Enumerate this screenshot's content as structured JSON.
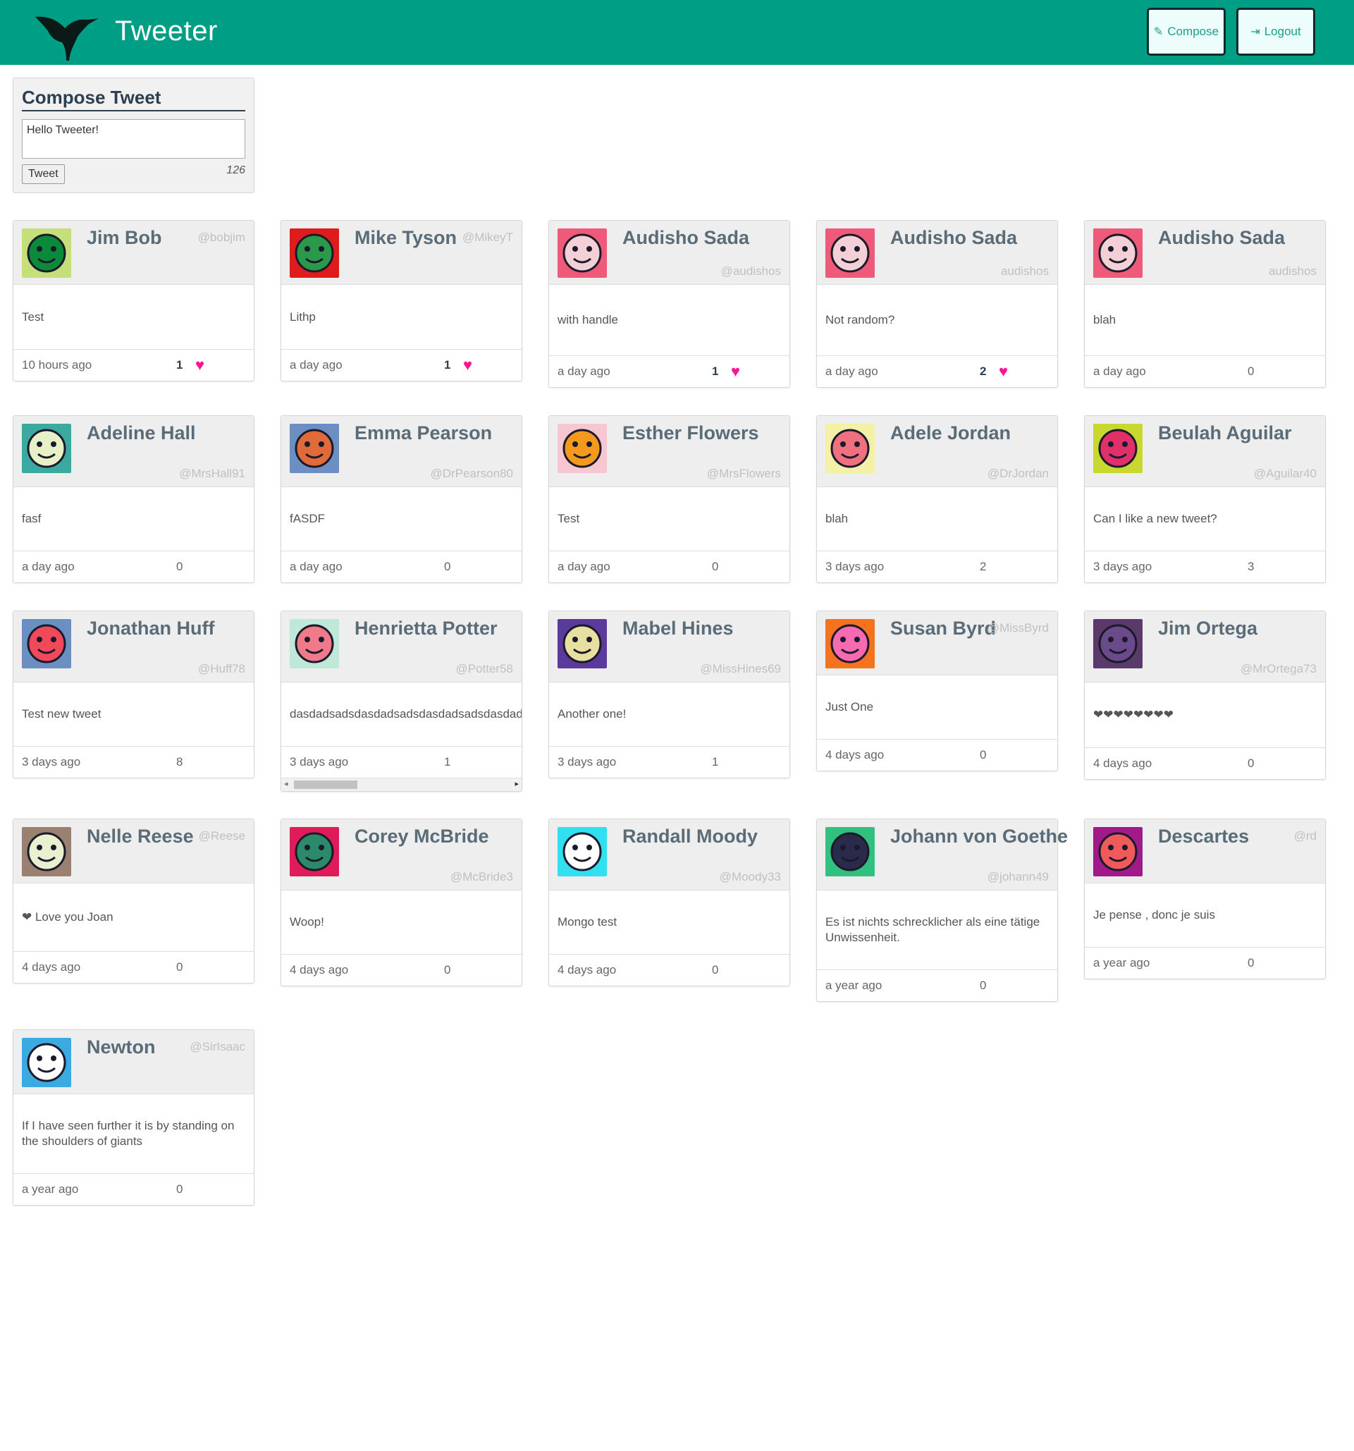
{
  "app": {
    "title": "Tweeter"
  },
  "nav": {
    "compose_label": "Compose",
    "logout_label": "Logout"
  },
  "compose": {
    "title": "Compose Tweet",
    "text": "Hello Tweeter!",
    "button": "Tweet",
    "count": "126"
  },
  "colors": {
    "header": "#009e85",
    "like": "#ff1493"
  },
  "tweets": [
    {
      "name": "Jim Bob",
      "handle": "@bobjim",
      "text": "Test",
      "time": "10 hours ago",
      "likes": "1",
      "liked": true,
      "avatar_bg": "#c5e07a",
      "avatar_fg": "#0a8a3a",
      "avatar_icon": "face-icon"
    },
    {
      "name": "Mike Tyson",
      "handle": "@MikeyT",
      "text": "Lithp",
      "time": "a day ago",
      "likes": "1",
      "liked": true,
      "avatar_bg": "#e01b1b",
      "avatar_fg": "#2a9a4a",
      "avatar_icon": "face-icon"
    },
    {
      "name": "Audisho Sada",
      "handle": "@audishos",
      "text": "with handle",
      "time": "a day ago",
      "likes": "1",
      "liked": true,
      "avatar_bg": "#f05a7a",
      "avatar_fg": "#f3d0d5",
      "avatar_icon": "face-icon"
    },
    {
      "name": "Audisho Sada",
      "handle": "audishos",
      "text": "Not random?",
      "time": "a day ago",
      "likes": "2",
      "liked": true,
      "avatar_bg": "#f05a7a",
      "avatar_fg": "#f3d0d5",
      "avatar_icon": "face-icon"
    },
    {
      "name": "Audisho Sada",
      "handle": "audishos",
      "text": "blah",
      "time": "a day ago",
      "likes": "0",
      "liked": false,
      "avatar_bg": "#f05a7a",
      "avatar_fg": "#f3d0d5",
      "avatar_icon": "face-icon"
    },
    {
      "name": "Adeline Hall",
      "handle": "@MrsHall91",
      "text": "fasf",
      "time": "a day ago",
      "likes": "0",
      "liked": false,
      "avatar_bg": "#3aa9a0",
      "avatar_fg": "#e8f0c8",
      "avatar_icon": "face-icon"
    },
    {
      "name": "Emma Pearson",
      "handle": "@DrPearson80",
      "text": "fASDF",
      "time": "a day ago",
      "likes": "0",
      "liked": false,
      "avatar_bg": "#6a8fc0",
      "avatar_fg": "#e06a3a",
      "avatar_icon": "face-icon"
    },
    {
      "name": "Esther Flowers",
      "handle": "@MrsFlowers",
      "text": "Test",
      "time": "a day ago",
      "likes": "0",
      "liked": false,
      "avatar_bg": "#f7c6d0",
      "avatar_fg": "#f39a1e",
      "avatar_icon": "face-icon"
    },
    {
      "name": "Adele Jordan",
      "handle": "@DrJordan",
      "text": "blah",
      "time": "3 days ago",
      "likes": "2",
      "liked": false,
      "avatar_bg": "#f5f0a8",
      "avatar_fg": "#f07080",
      "avatar_icon": "face-icon"
    },
    {
      "name": "Beulah Aguilar",
      "handle": "@Aguilar40",
      "text": "Can I like a new tweet?",
      "time": "3 days ago",
      "likes": "3",
      "liked": false,
      "avatar_bg": "#c8d830",
      "avatar_fg": "#e0306a",
      "avatar_icon": "face-icon"
    },
    {
      "name": "Jonathan Huff",
      "handle": "@Huff78",
      "text": "Test new tweet",
      "time": "3 days ago",
      "likes": "8",
      "liked": false,
      "avatar_bg": "#6a8fc0",
      "avatar_fg": "#f04a5a",
      "avatar_icon": "face-icon"
    },
    {
      "name": "Henrietta Potter",
      "handle": "@Potter58",
      "text": "dasdadsadsdasdadsadsdasdadsadsdasdadsadsdasdadsadsdas",
      "time": "3 days ago",
      "likes": "1",
      "liked": false,
      "avatar_bg": "#bfe8d8",
      "avatar_fg": "#f07a8a",
      "avatar_icon": "face-icon"
    },
    {
      "name": "Mabel Hines",
      "handle": "@MissHines69",
      "text": "Another one!",
      "time": "3 days ago",
      "likes": "1",
      "liked": false,
      "avatar_bg": "#5a3a9a",
      "avatar_fg": "#e8e0a0",
      "avatar_icon": "face-icon"
    },
    {
      "name": "Susan Byrd",
      "handle": "@MissByrd",
      "text": "Just One",
      "time": "4 days ago",
      "likes": "0",
      "liked": false,
      "avatar_bg": "#f5721e",
      "avatar_fg": "#f56ab0",
      "avatar_icon": "face-icon"
    },
    {
      "name": "Jim Ortega",
      "handle": "@MrOrtega73",
      "text": "❤❤❤❤❤❤❤❤",
      "time": "4 days ago",
      "likes": "0",
      "liked": false,
      "avatar_bg": "#5a3a6a",
      "avatar_fg": "#6a4a8a",
      "avatar_icon": "face-icon"
    },
    {
      "name": "Nelle Reese",
      "handle": "@Reese",
      "text": "❤ Love you Joan",
      "time": "4 days ago",
      "likes": "0",
      "liked": false,
      "avatar_bg": "#9a8070",
      "avatar_fg": "#e8f0d0",
      "avatar_icon": "face-icon"
    },
    {
      "name": "Corey McBride",
      "handle": "@McBride3",
      "text": "Woop!",
      "time": "4 days ago",
      "likes": "0",
      "liked": false,
      "avatar_bg": "#e01b5a",
      "avatar_fg": "#2a8a6a",
      "avatar_icon": "face-icon"
    },
    {
      "name": "Randall Moody",
      "handle": "@Moody33",
      "text": "Mongo test",
      "time": "4 days ago",
      "likes": "0",
      "liked": false,
      "avatar_bg": "#30e0f0",
      "avatar_fg": "#ffffff",
      "avatar_icon": "face-icon"
    },
    {
      "name": "Johann von Goethe",
      "handle": "@johann49",
      "text": "Es ist nichts schrecklicher als eine tätige Unwissenheit.",
      "time": "a year ago",
      "likes": "0",
      "liked": false,
      "avatar_bg": "#30c080",
      "avatar_fg": "#2a2a4a",
      "avatar_icon": "face-icon"
    },
    {
      "name": "Descartes",
      "handle": "@rd",
      "text": "Je pense , donc je suis",
      "time": "a year ago",
      "likes": "0",
      "liked": false,
      "avatar_bg": "#a01a8a",
      "avatar_fg": "#f05a5a",
      "avatar_icon": "face-icon"
    },
    {
      "name": "Newton",
      "handle": "@SirIsaac",
      "text": "If I have seen further it is by standing on the shoulders of giants",
      "time": "a year ago",
      "likes": "0",
      "liked": false,
      "avatar_bg": "#3aaae0",
      "avatar_fg": "#ffffff",
      "avatar_icon": "face-icon"
    }
  ]
}
